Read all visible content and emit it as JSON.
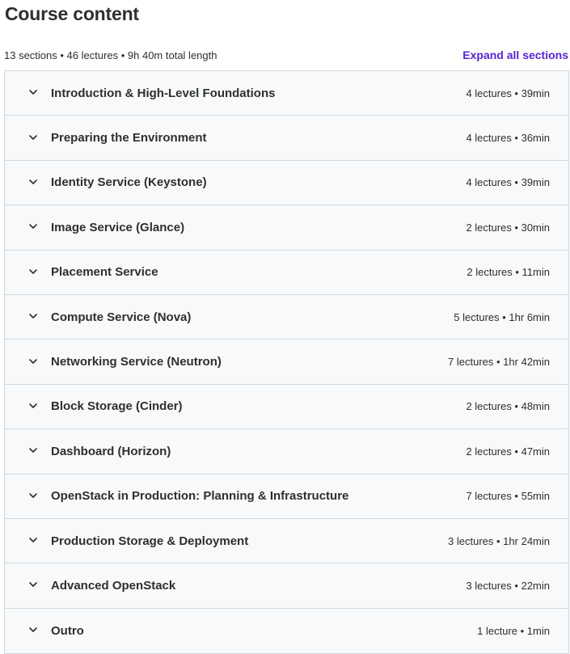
{
  "header": {
    "title": "Course content",
    "summary": "13 sections • 46 lectures • 9h 40m total length",
    "expand_label": "Expand all sections"
  },
  "icons": {
    "section_toggle": "chevron-down-icon"
  },
  "colors": {
    "accent": "#5624d0",
    "section_bg": "#f7f9fa",
    "border": "#d1d7dc",
    "text": "#2d2f31"
  },
  "sections": [
    {
      "title": "Introduction & High-Level Foundations",
      "meta": "4 lectures • 39min"
    },
    {
      "title": "Preparing the Environment",
      "meta": "4 lectures • 36min"
    },
    {
      "title": "Identity Service (Keystone)",
      "meta": "4 lectures • 39min"
    },
    {
      "title": "Image Service (Glance)",
      "meta": "2 lectures • 30min"
    },
    {
      "title": "Placement Service",
      "meta": "2 lectures • 11min"
    },
    {
      "title": "Compute Service (Nova)",
      "meta": "5 lectures • 1hr 6min"
    },
    {
      "title": "Networking Service (Neutron)",
      "meta": "7 lectures • 1hr 42min"
    },
    {
      "title": "Block Storage (Cinder)",
      "meta": "2 lectures • 48min"
    },
    {
      "title": "Dashboard (Horizon)",
      "meta": "2 lectures • 47min"
    },
    {
      "title": "OpenStack in Production: Planning & Infrastructure",
      "meta": "7 lectures • 55min"
    },
    {
      "title": "Production Storage & Deployment",
      "meta": "3 lectures • 1hr 24min"
    },
    {
      "title": "Advanced OpenStack",
      "meta": "3 lectures • 22min"
    },
    {
      "title": "Outro",
      "meta": "1 lecture • 1min"
    }
  ]
}
